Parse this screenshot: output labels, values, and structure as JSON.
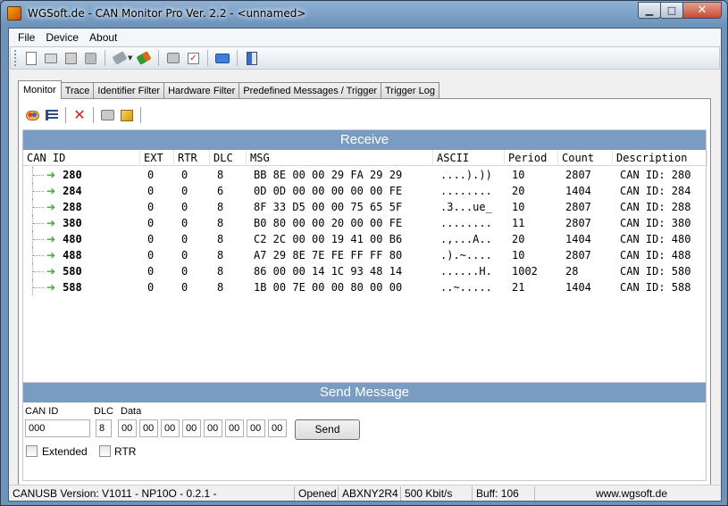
{
  "window": {
    "title": "WGSoft.de - CAN Monitor Pro Ver. 2.2 - <unnamed>",
    "minimize_glyph": "▁",
    "maximize_glyph": "□",
    "close_glyph": "✕"
  },
  "menu": {
    "file": "File",
    "device": "Device",
    "about": "About"
  },
  "toolbar_icons": [
    "new-document-icon",
    "open-folder-icon",
    "save-icon",
    "save-as-icon",
    "disconnect-plug-icon",
    "connect-plug-icon",
    "print-icon",
    "properties-icon",
    "keyboard-icon",
    "exit-door-icon"
  ],
  "tabs": [
    {
      "label": "Monitor",
      "active": true
    },
    {
      "label": "Trace"
    },
    {
      "label": "Identifier Filter"
    },
    {
      "label": "Hardware Filter"
    },
    {
      "label": "Predefined Messages / Trigger"
    },
    {
      "label": "Trigger Log"
    }
  ],
  "receive": {
    "header": "Receive",
    "columns": {
      "can_id": "CAN ID",
      "ext": "EXT",
      "rtr": "RTR",
      "dlc": "DLC",
      "msg": "MSG",
      "ascii": "ASCII",
      "period": "Period",
      "count": "Count",
      "description": "Description"
    },
    "rows": [
      {
        "id": "280",
        "ext": "0",
        "rtr": "0",
        "dlc": "8",
        "msg": "BB 8E 00 00 29 FA 29 29",
        "ascii": "....).))",
        "period": "10",
        "count": "2807",
        "desc": "CAN ID: 280"
      },
      {
        "id": "284",
        "ext": "0",
        "rtr": "0",
        "dlc": "6",
        "msg": "0D 0D 00 00 00 00 00 FE",
        "ascii": "........",
        "period": "20",
        "count": "1404",
        "desc": "CAN ID: 284"
      },
      {
        "id": "288",
        "ext": "0",
        "rtr": "0",
        "dlc": "8",
        "msg": "8F 33 D5 00 00 75 65 5F",
        "ascii": ".3...ue_",
        "period": "10",
        "count": "2807",
        "desc": "CAN ID: 288"
      },
      {
        "id": "380",
        "ext": "0",
        "rtr": "0",
        "dlc": "8",
        "msg": "B0 80 00 00 20 00 00 FE",
        "ascii": "........",
        "period": "11",
        "count": "2807",
        "desc": "CAN ID: 380"
      },
      {
        "id": "480",
        "ext": "0",
        "rtr": "0",
        "dlc": "8",
        "msg": "C2 2C 00 00 19 41 00 B6",
        "ascii": ".,...A..",
        "period": "20",
        "count": "1404",
        "desc": "CAN ID: 480"
      },
      {
        "id": "488",
        "ext": "0",
        "rtr": "0",
        "dlc": "8",
        "msg": "A7 29 8E 7E FE FF FF 80",
        "ascii": ".).~....",
        "period": "10",
        "count": "2807",
        "desc": "CAN ID: 488"
      },
      {
        "id": "580",
        "ext": "0",
        "rtr": "0",
        "dlc": "8",
        "msg": "86 00 00 14 1C 93 48 14",
        "ascii": "......H.",
        "period": "1002",
        "count": "28",
        "desc": "CAN ID: 580"
      },
      {
        "id": "588",
        "ext": "0",
        "rtr": "0",
        "dlc": "8",
        "msg": "1B 00 7E 00 00 80 00 00",
        "ascii": "..~.....",
        "period": "21",
        "count": "1404",
        "desc": "CAN ID: 588"
      }
    ]
  },
  "send": {
    "header": "Send Message",
    "can_id_label": "CAN ID",
    "dlc_label": "DLC",
    "data_label": "Data",
    "can_id_value": "000",
    "dlc_value": "8",
    "data_bytes": [
      "00",
      "00",
      "00",
      "00",
      "00",
      "00",
      "00",
      "00"
    ],
    "send_button": "Send",
    "extended_label": "Extended",
    "rtr_label": "RTR",
    "extended_checked": false,
    "rtr_checked": false
  },
  "status": {
    "version": "CANUSB Version: V1011 - NP10O - 0.2.1 -",
    "state": "Opened",
    "serial": "ABXNY2R4",
    "bitrate": "500 Kbit/s",
    "buffer": "Buff: 106",
    "website": "www.wgsoft.de"
  }
}
